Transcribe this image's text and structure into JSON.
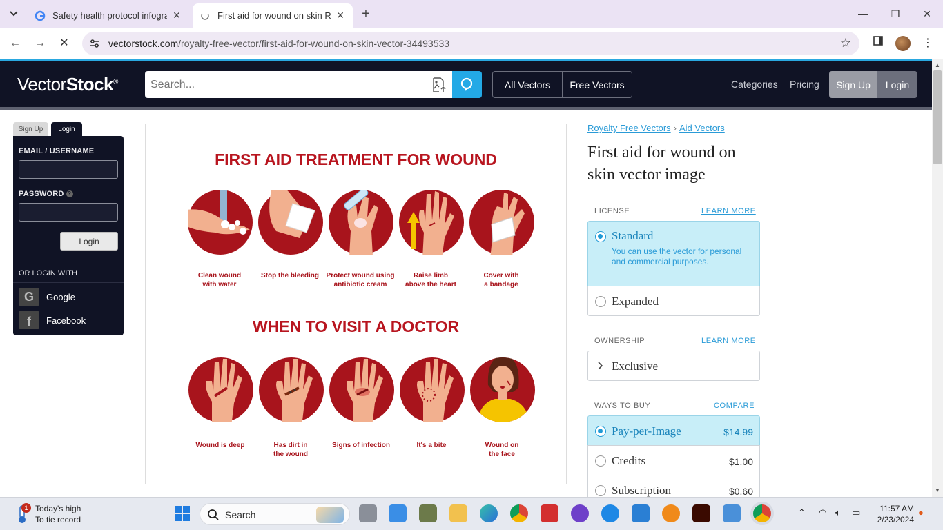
{
  "browser": {
    "tabs": [
      {
        "title": "Safety health protocol infograp",
        "active": false
      },
      {
        "title": "First aid for wound on skin Roy",
        "active": true
      }
    ],
    "url_host": "vectorstock.com",
    "url_path": "/royalty-free-vector/first-aid-for-wound-on-skin-vector-34493533"
  },
  "header": {
    "logo_light": "Vector",
    "logo_bold": "Stock",
    "logo_mark": "®",
    "search_placeholder": "Search...",
    "all_vectors": "All Vectors",
    "free_vectors": "Free Vectors",
    "categories": "Categories",
    "pricing": "Pricing",
    "sign_up": "Sign Up",
    "login": "Login"
  },
  "login_panel": {
    "tab_signup": "Sign Up",
    "tab_login": "Login",
    "email_label": "EMAIL / USERNAME",
    "password_label": "PASSWORD",
    "help_glyph": "?",
    "login_button": "Login",
    "or_login_with": "OR LOGIN WITH",
    "social": [
      {
        "name": "Google",
        "glyph": "G"
      },
      {
        "name": "Facebook",
        "glyph": "f"
      }
    ]
  },
  "infographic": {
    "title1": "FIRST AID TREATMENT FOR WOUND",
    "title2": "WHEN TO VISIT A DOCTOR",
    "row1": [
      {
        "l1": "Clean wound",
        "l2": "with water"
      },
      {
        "l1": "Stop the bleeding",
        "l2": ""
      },
      {
        "l1": "Protect wound using",
        "l2": "antibiotic cream"
      },
      {
        "l1": "Raise limb",
        "l2": "above the heart"
      },
      {
        "l1": "Cover with",
        "l2": "a bandage"
      }
    ],
    "row2": [
      {
        "l1": "Wound is deep",
        "l2": ""
      },
      {
        "l1": "Has dirt in",
        "l2": "the wound"
      },
      {
        "l1": "Signs of infection",
        "l2": ""
      },
      {
        "l1": "It's a bite",
        "l2": ""
      },
      {
        "l1": "Wound on",
        "l2": "the face"
      }
    ],
    "accent_color": "#a8141c"
  },
  "product": {
    "crumb1": "Royalty Free Vectors",
    "crumb_sep": "›",
    "crumb2": "Aid Vectors",
    "title": "First aid for wound on skin vector image",
    "license_label": "LICENSE",
    "learn_more": "LEARN MORE",
    "standard": "Standard",
    "standard_desc": "You can use the vector for personal and commercial purposes.",
    "expanded": "Expanded",
    "ownership_label": "OWNERSHIP",
    "exclusive": "Exclusive",
    "ways_label": "WAYS TO BUY",
    "compare": "COMPARE",
    "options": [
      {
        "name": "Pay-per-Image",
        "price": "$14.99",
        "selected": true
      },
      {
        "name": "Credits",
        "price": "$1.00",
        "selected": false
      },
      {
        "name": "Subscription",
        "price": "$0.60",
        "selected": false
      }
    ]
  },
  "taskbar": {
    "weather_line1": "Today's high",
    "weather_line2": "To tie record",
    "weather_badge": "1",
    "search": "Search",
    "time": "11:57 AM",
    "date": "2/23/2024"
  }
}
